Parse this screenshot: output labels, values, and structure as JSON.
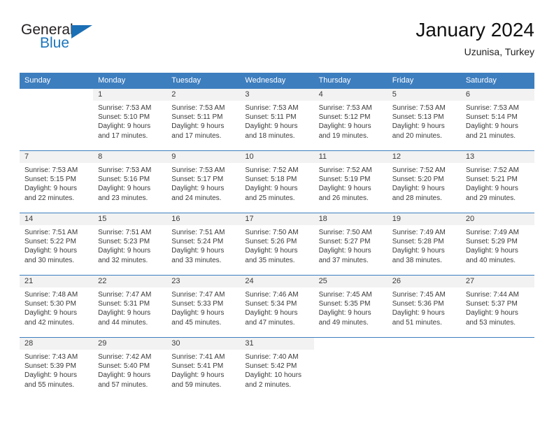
{
  "brand": {
    "name_top": "General",
    "name_bottom": "Blue"
  },
  "header": {
    "title": "January 2024",
    "location": "Uzunisa, Turkey"
  },
  "colors": {
    "header_blue": "#3d7ebf",
    "brand_blue": "#1b75bb",
    "daynum_band": "#f2f2f2",
    "text": "#3a3a3a"
  },
  "weekdays": [
    "Sunday",
    "Monday",
    "Tuesday",
    "Wednesday",
    "Thursday",
    "Friday",
    "Saturday"
  ],
  "weeks": [
    [
      {
        "day": "",
        "sunrise": "",
        "sunset": "",
        "daylight1": "",
        "daylight2": ""
      },
      {
        "day": "1",
        "sunrise": "Sunrise: 7:53 AM",
        "sunset": "Sunset: 5:10 PM",
        "daylight1": "Daylight: 9 hours",
        "daylight2": "and 17 minutes."
      },
      {
        "day": "2",
        "sunrise": "Sunrise: 7:53 AM",
        "sunset": "Sunset: 5:11 PM",
        "daylight1": "Daylight: 9 hours",
        "daylight2": "and 17 minutes."
      },
      {
        "day": "3",
        "sunrise": "Sunrise: 7:53 AM",
        "sunset": "Sunset: 5:11 PM",
        "daylight1": "Daylight: 9 hours",
        "daylight2": "and 18 minutes."
      },
      {
        "day": "4",
        "sunrise": "Sunrise: 7:53 AM",
        "sunset": "Sunset: 5:12 PM",
        "daylight1": "Daylight: 9 hours",
        "daylight2": "and 19 minutes."
      },
      {
        "day": "5",
        "sunrise": "Sunrise: 7:53 AM",
        "sunset": "Sunset: 5:13 PM",
        "daylight1": "Daylight: 9 hours",
        "daylight2": "and 20 minutes."
      },
      {
        "day": "6",
        "sunrise": "Sunrise: 7:53 AM",
        "sunset": "Sunset: 5:14 PM",
        "daylight1": "Daylight: 9 hours",
        "daylight2": "and 21 minutes."
      }
    ],
    [
      {
        "day": "7",
        "sunrise": "Sunrise: 7:53 AM",
        "sunset": "Sunset: 5:15 PM",
        "daylight1": "Daylight: 9 hours",
        "daylight2": "and 22 minutes."
      },
      {
        "day": "8",
        "sunrise": "Sunrise: 7:53 AM",
        "sunset": "Sunset: 5:16 PM",
        "daylight1": "Daylight: 9 hours",
        "daylight2": "and 23 minutes."
      },
      {
        "day": "9",
        "sunrise": "Sunrise: 7:53 AM",
        "sunset": "Sunset: 5:17 PM",
        "daylight1": "Daylight: 9 hours",
        "daylight2": "and 24 minutes."
      },
      {
        "day": "10",
        "sunrise": "Sunrise: 7:52 AM",
        "sunset": "Sunset: 5:18 PM",
        "daylight1": "Daylight: 9 hours",
        "daylight2": "and 25 minutes."
      },
      {
        "day": "11",
        "sunrise": "Sunrise: 7:52 AM",
        "sunset": "Sunset: 5:19 PM",
        "daylight1": "Daylight: 9 hours",
        "daylight2": "and 26 minutes."
      },
      {
        "day": "12",
        "sunrise": "Sunrise: 7:52 AM",
        "sunset": "Sunset: 5:20 PM",
        "daylight1": "Daylight: 9 hours",
        "daylight2": "and 28 minutes."
      },
      {
        "day": "13",
        "sunrise": "Sunrise: 7:52 AM",
        "sunset": "Sunset: 5:21 PM",
        "daylight1": "Daylight: 9 hours",
        "daylight2": "and 29 minutes."
      }
    ],
    [
      {
        "day": "14",
        "sunrise": "Sunrise: 7:51 AM",
        "sunset": "Sunset: 5:22 PM",
        "daylight1": "Daylight: 9 hours",
        "daylight2": "and 30 minutes."
      },
      {
        "day": "15",
        "sunrise": "Sunrise: 7:51 AM",
        "sunset": "Sunset: 5:23 PM",
        "daylight1": "Daylight: 9 hours",
        "daylight2": "and 32 minutes."
      },
      {
        "day": "16",
        "sunrise": "Sunrise: 7:51 AM",
        "sunset": "Sunset: 5:24 PM",
        "daylight1": "Daylight: 9 hours",
        "daylight2": "and 33 minutes."
      },
      {
        "day": "17",
        "sunrise": "Sunrise: 7:50 AM",
        "sunset": "Sunset: 5:26 PM",
        "daylight1": "Daylight: 9 hours",
        "daylight2": "and 35 minutes."
      },
      {
        "day": "18",
        "sunrise": "Sunrise: 7:50 AM",
        "sunset": "Sunset: 5:27 PM",
        "daylight1": "Daylight: 9 hours",
        "daylight2": "and 37 minutes."
      },
      {
        "day": "19",
        "sunrise": "Sunrise: 7:49 AM",
        "sunset": "Sunset: 5:28 PM",
        "daylight1": "Daylight: 9 hours",
        "daylight2": "and 38 minutes."
      },
      {
        "day": "20",
        "sunrise": "Sunrise: 7:49 AM",
        "sunset": "Sunset: 5:29 PM",
        "daylight1": "Daylight: 9 hours",
        "daylight2": "and 40 minutes."
      }
    ],
    [
      {
        "day": "21",
        "sunrise": "Sunrise: 7:48 AM",
        "sunset": "Sunset: 5:30 PM",
        "daylight1": "Daylight: 9 hours",
        "daylight2": "and 42 minutes."
      },
      {
        "day": "22",
        "sunrise": "Sunrise: 7:47 AM",
        "sunset": "Sunset: 5:31 PM",
        "daylight1": "Daylight: 9 hours",
        "daylight2": "and 44 minutes."
      },
      {
        "day": "23",
        "sunrise": "Sunrise: 7:47 AM",
        "sunset": "Sunset: 5:33 PM",
        "daylight1": "Daylight: 9 hours",
        "daylight2": "and 45 minutes."
      },
      {
        "day": "24",
        "sunrise": "Sunrise: 7:46 AM",
        "sunset": "Sunset: 5:34 PM",
        "daylight1": "Daylight: 9 hours",
        "daylight2": "and 47 minutes."
      },
      {
        "day": "25",
        "sunrise": "Sunrise: 7:45 AM",
        "sunset": "Sunset: 5:35 PM",
        "daylight1": "Daylight: 9 hours",
        "daylight2": "and 49 minutes."
      },
      {
        "day": "26",
        "sunrise": "Sunrise: 7:45 AM",
        "sunset": "Sunset: 5:36 PM",
        "daylight1": "Daylight: 9 hours",
        "daylight2": "and 51 minutes."
      },
      {
        "day": "27",
        "sunrise": "Sunrise: 7:44 AM",
        "sunset": "Sunset: 5:37 PM",
        "daylight1": "Daylight: 9 hours",
        "daylight2": "and 53 minutes."
      }
    ],
    [
      {
        "day": "28",
        "sunrise": "Sunrise: 7:43 AM",
        "sunset": "Sunset: 5:39 PM",
        "daylight1": "Daylight: 9 hours",
        "daylight2": "and 55 minutes."
      },
      {
        "day": "29",
        "sunrise": "Sunrise: 7:42 AM",
        "sunset": "Sunset: 5:40 PM",
        "daylight1": "Daylight: 9 hours",
        "daylight2": "and 57 minutes."
      },
      {
        "day": "30",
        "sunrise": "Sunrise: 7:41 AM",
        "sunset": "Sunset: 5:41 PM",
        "daylight1": "Daylight: 9 hours",
        "daylight2": "and 59 minutes."
      },
      {
        "day": "31",
        "sunrise": "Sunrise: 7:40 AM",
        "sunset": "Sunset: 5:42 PM",
        "daylight1": "Daylight: 10 hours",
        "daylight2": "and 2 minutes."
      },
      {
        "day": "",
        "sunrise": "",
        "sunset": "",
        "daylight1": "",
        "daylight2": ""
      },
      {
        "day": "",
        "sunrise": "",
        "sunset": "",
        "daylight1": "",
        "daylight2": ""
      },
      {
        "day": "",
        "sunrise": "",
        "sunset": "",
        "daylight1": "",
        "daylight2": ""
      }
    ]
  ]
}
